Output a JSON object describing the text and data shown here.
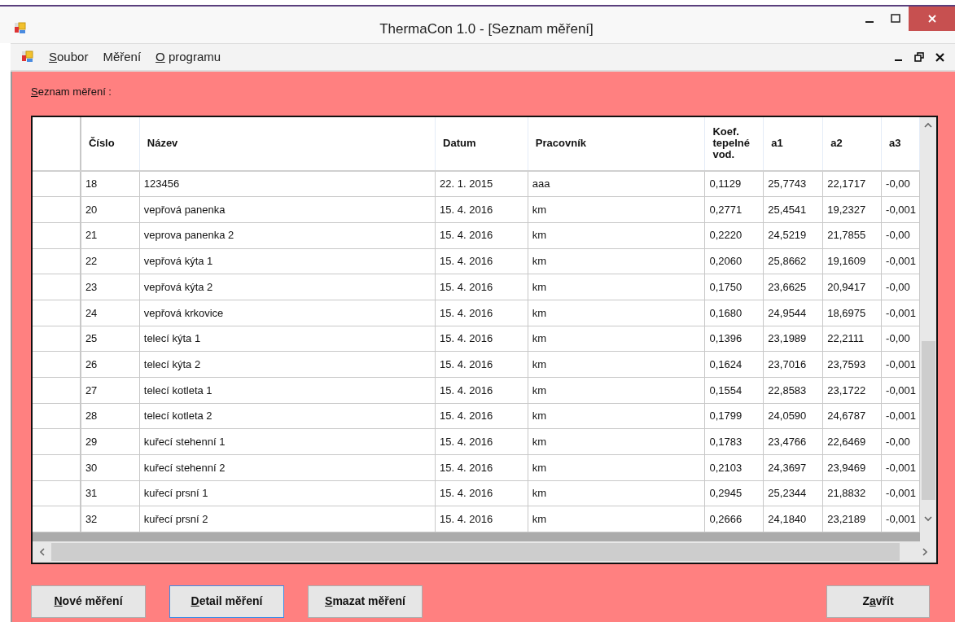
{
  "window": {
    "title": "ThermaCon 1.0 - [Seznam měření]"
  },
  "menu": {
    "items": [
      {
        "key": "S",
        "after": "oubor"
      },
      {
        "before": "Měření"
      },
      {
        "key": "O",
        "after": " programu"
      }
    ]
  },
  "section_label": {
    "key": "S",
    "after": "eznam měření :"
  },
  "table": {
    "columns": [
      "Číslo",
      "Název",
      "Datum",
      "Pracovník",
      "Koef. tepelné vod.",
      "a1",
      "a2",
      "a3"
    ],
    "rows": [
      [
        "18",
        "123456",
        "22. 1. 2015",
        "aaa",
        "0,1129",
        "25,7743",
        "22,1717",
        "-0,00"
      ],
      [
        "20",
        "vepřová panenka",
        "15. 4. 2016",
        "km",
        "0,2771",
        "25,4541",
        "19,2327",
        "-0,001"
      ],
      [
        "21",
        "veprova panenka 2",
        "15. 4. 2016",
        "km",
        "0,2220",
        "24,5219",
        "21,7855",
        "-0,00"
      ],
      [
        "22",
        "vepřová kýta 1",
        "15. 4. 2016",
        "km",
        "0,2060",
        "25,8662",
        "19,1609",
        "-0,001"
      ],
      [
        "23",
        "vepřová kýta 2",
        "15. 4. 2016",
        "km",
        "0,1750",
        "23,6625",
        "20,9417",
        "-0,00"
      ],
      [
        "24",
        "vepřová krkovice",
        "15. 4. 2016",
        "km",
        "0,1680",
        "24,9544",
        "18,6975",
        "-0,001"
      ],
      [
        "25",
        "telecí kýta 1",
        "15. 4. 2016",
        "km",
        "0,1396",
        "23,1989",
        "22,2111",
        "-0,00"
      ],
      [
        "26",
        "telecí kýta 2",
        "15. 4. 2016",
        "km",
        "0,1624",
        "23,7016",
        "23,7593",
        "-0,001"
      ],
      [
        "27",
        "telecí kotleta 1",
        "15. 4. 2016",
        "km",
        "0,1554",
        "22,8583",
        "23,1722",
        "-0,001"
      ],
      [
        "28",
        "telecí kotleta 2",
        "15. 4. 2016",
        "km",
        "0,1799",
        "24,0590",
        "24,6787",
        "-0,001"
      ],
      [
        "29",
        "kuřecí stehenní 1",
        "15. 4. 2016",
        "km",
        "0,1783",
        "23,4766",
        "22,6469",
        "-0,00"
      ],
      [
        "30",
        "kuřecí stehenní 2",
        "15. 4. 2016",
        "km",
        "0,2103",
        "24,3697",
        "23,9469",
        "-0,001"
      ],
      [
        "31",
        "kuřecí prsní 1",
        "15. 4. 2016",
        "km",
        "0,2945",
        "25,2344",
        "21,8832",
        "-0,001"
      ],
      [
        "32",
        "kuřecí prsní 2",
        "15. 4. 2016",
        "km",
        "0,2666",
        "24,1840",
        "23,2189",
        "-0,001"
      ]
    ]
  },
  "buttons": [
    {
      "key": "N",
      "after": "ové měření",
      "focused": false
    },
    {
      "key": "D",
      "after": "etail měření",
      "focused": true
    },
    {
      "key": "S",
      "after": "mazat měření",
      "focused": false
    },
    {
      "before": "Z",
      "key": "a",
      "after": "vřít",
      "focused": false
    }
  ]
}
